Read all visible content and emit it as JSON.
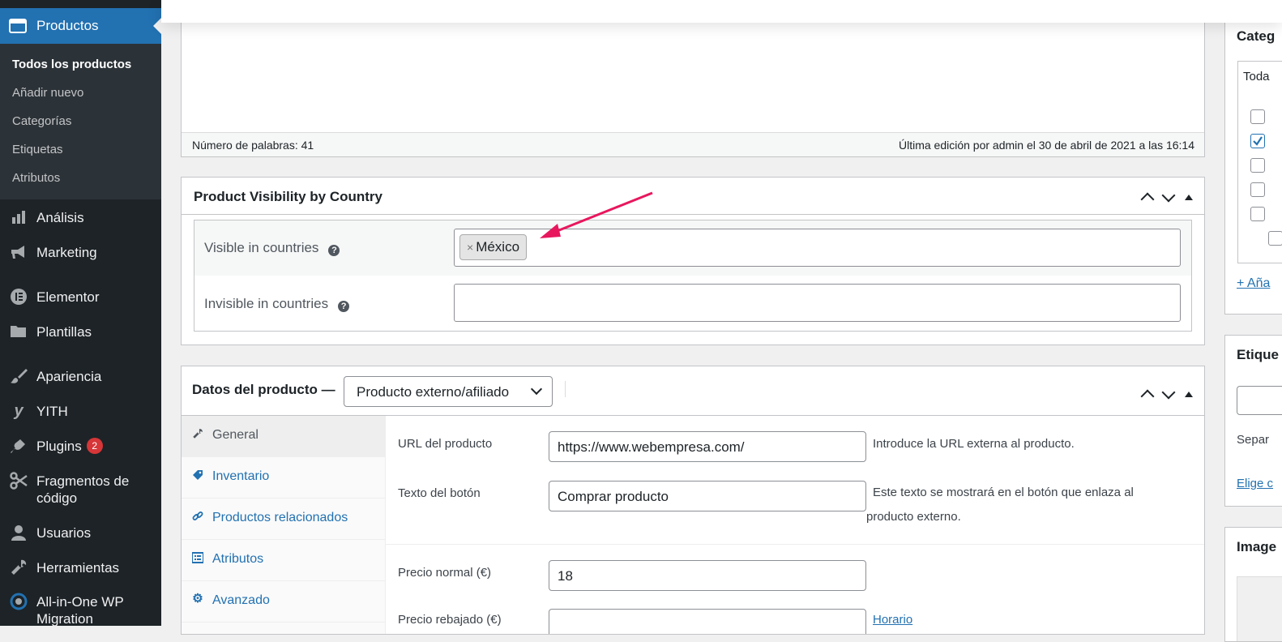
{
  "sidebar": {
    "active_label": "Productos",
    "submenu": [
      "Todos los productos",
      "Añadir nuevo",
      "Categorías",
      "Etiquetas",
      "Atributos"
    ],
    "items": [
      {
        "label": "Análisis",
        "icon": "bar-chart-icon"
      },
      {
        "label": "Marketing",
        "icon": "megaphone-icon"
      },
      {
        "label": "Elementor",
        "icon": "elementor-icon"
      },
      {
        "label": "Plantillas",
        "icon": "folder-icon"
      },
      {
        "label": "Apariencia",
        "icon": "paintbrush-icon"
      },
      {
        "label": "YITH",
        "icon": "yith-icon"
      },
      {
        "label": "Plugins",
        "icon": "plug-icon",
        "badge": "2"
      },
      {
        "label": "Fragmentos de código",
        "icon": "scissors-icon"
      },
      {
        "label": "Usuarios",
        "icon": "user-icon"
      },
      {
        "label": "Herramientas",
        "icon": "wrench-icon"
      },
      {
        "label": "All-in-One WP Migration",
        "icon": "migration-icon"
      }
    ]
  },
  "editor": {
    "word_count": "Número de palabras: 41",
    "last_edit": "Última edición por admin el 30 de abril de 2021 a las 16:14"
  },
  "visibility_box": {
    "title": "Product Visibility by Country",
    "visible_label": "Visible in countries",
    "visible_tags": [
      "México"
    ],
    "invisible_label": "Invisible in countries",
    "help_glyph": "?"
  },
  "product_data": {
    "title": "Datos del producto —",
    "type_select": "Producto externo/afiliado",
    "tabs": [
      "General",
      "Inventario",
      "Productos relacionados",
      "Atributos",
      "Avanzado"
    ],
    "fields": {
      "url_label": "URL del producto",
      "url_value": "https://www.webempresa.com/",
      "url_desc": "Introduce la URL externa al producto.",
      "button_label": "Texto del botón",
      "button_value": "Comprar producto",
      "button_desc_1": "Este texto se mostrará en el botón que enlaza al",
      "button_desc_2": "producto externo.",
      "price_label": "Precio normal (€)",
      "price_value": "18",
      "sale_label": "Precio rebajado (€)",
      "sale_link": "Horario"
    }
  },
  "right_column": {
    "categories_title": "Categ",
    "categories_tab": "Toda",
    "add_category": "+ Aña",
    "tags_title": "Etique",
    "tags_sep": "Separ",
    "tags_choose": "Elige c",
    "image_title": "Image"
  },
  "colors": {
    "accent": "#2271b1",
    "arrow": "#e8175d",
    "sidebar": "#1d2327"
  }
}
